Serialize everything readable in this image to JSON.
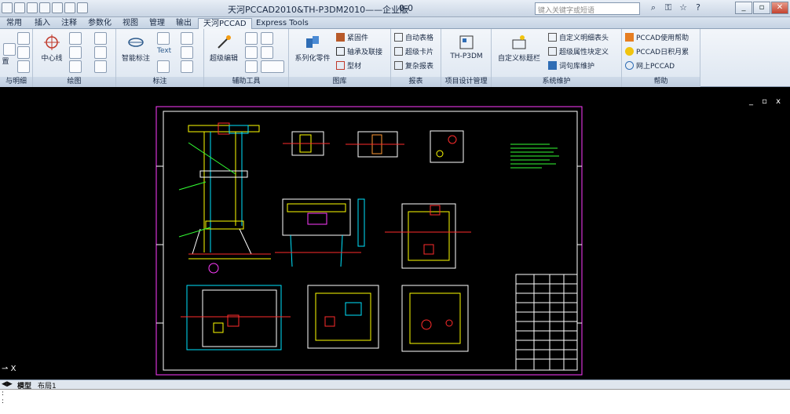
{
  "title_bar": {
    "app_title": "天河PCCAD2010&TH-P3DM2010——企业版",
    "doc_name": "0-0",
    "search_placeholder": "键入关键字或短语"
  },
  "tabs": [
    "常用",
    "插入",
    "注释",
    "参数化",
    "视图",
    "管理",
    "输出",
    "天河PCCAD",
    "Express Tools"
  ],
  "active_tab": "天河PCCAD",
  "ribbon": {
    "groups": {
      "g0": "与明细",
      "g1": "绘图",
      "g2": "标注",
      "g3": "辅助工具",
      "g4": "图库",
      "g5": "报表",
      "g6": "项目设计管理",
      "g7": "系统维护",
      "g8": "帮助"
    },
    "buttons": {
      "g0_cut": "置",
      "centerline": "中心线",
      "smart_dim": "智能标注",
      "text_tool": "Text",
      "super_edit": "超级编辑",
      "series_parts": "系列化零件",
      "fastener": "紧固件",
      "bearing": "轴承及联接",
      "profile": "型材",
      "auto_table": "自动表格",
      "super_card": "超级卡片",
      "complex_report": "复杂报表",
      "th_p3dm": "TH-P3DM",
      "custom_title": "自定义标题栏",
      "custom_detail": "自定义明细表头",
      "super_attr": "超级属性块定义",
      "lib_maint": "词句库维护",
      "help1": "PCCAD使用帮助",
      "help2": "PCCAD日积月累",
      "help3": "网上PCCAD"
    }
  },
  "layout_tabs": [
    "模型",
    "布局1"
  ],
  "active_layout": "模型",
  "command_line": {
    "line1": ":",
    "line2": ":"
  },
  "ucs_label": "X",
  "mdi_controls": "_ ▫ x",
  "colors": {
    "drawing_bg": "#000000",
    "cad_cyan": "#00e5ff",
    "cad_yellow": "#ffff00",
    "cad_green": "#33ff33",
    "cad_red": "#ff2b2b",
    "cad_magenta": "#ff3cff",
    "cad_white": "#ffffff"
  }
}
